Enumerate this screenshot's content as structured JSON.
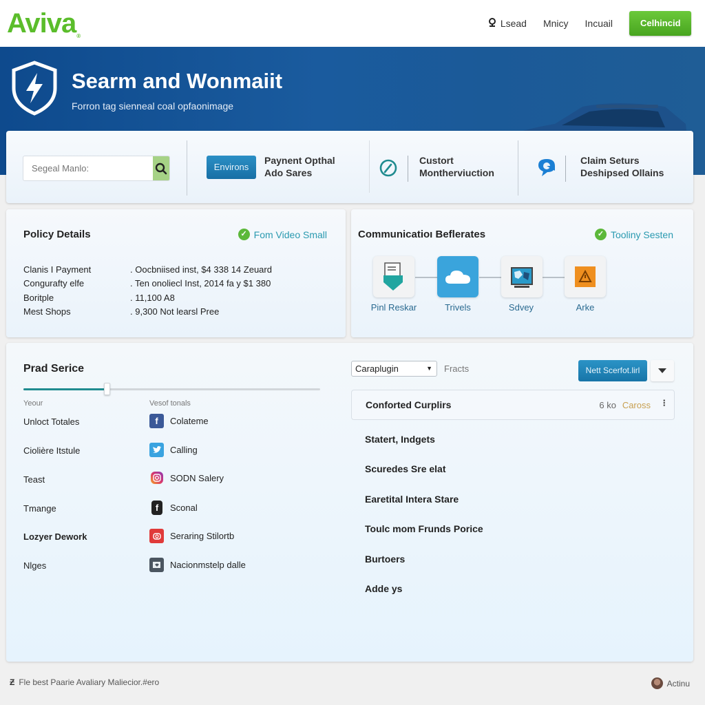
{
  "header": {
    "logo": "Aviva",
    "logo_mark": "®",
    "nav": [
      {
        "label": "Lsead",
        "icon": "location-pin-icon"
      },
      {
        "label": "Mnicy"
      },
      {
        "label": "Incuail"
      }
    ],
    "cta_label": "Celhincid"
  },
  "hero": {
    "title": "Searm and Wonmaiit",
    "subtitle": "Forron tag sienneal coal opfaonimage",
    "icon": "shield-lightning-icon"
  },
  "service_strip": {
    "search": {
      "placeholder": "Segeal Manlo:",
      "value": ""
    },
    "environs_button": "Environs",
    "items": [
      {
        "line1": "Paynent Opthal",
        "line2": "Ado Sares"
      },
      {
        "line1": "Custort",
        "line2": "Montherviuction",
        "icon": "gauge-icon"
      },
      {
        "line1": "Claim Seturs",
        "line2": "Deshipsed Ollains",
        "icon": "chat-refresh-icon"
      }
    ]
  },
  "policy_details": {
    "title": "Policy Details",
    "badge": "Fom Video Small",
    "rows": [
      {
        "label": "Clanis I Payment",
        "value": ". Oocbniised inst, $4 338 14 Zeuard"
      },
      {
        "label": "Congurafty elfe",
        "value": ". Ten onoliecl Inst, 2014 fa y $1 380"
      },
      {
        "label": "Boritple",
        "value": ". 11,100 A8"
      },
      {
        "label": "Mest Shops",
        "value": ". 9,300 Not learsl Pree"
      }
    ]
  },
  "communication": {
    "title": "Communicatioı Beflerates",
    "badge": "Tooliny Sesten",
    "steps": [
      {
        "label": "Pinl Reskar",
        "icon": "document-shield-icon"
      },
      {
        "label": "Trivels",
        "icon": "cloud-icon"
      },
      {
        "label": "Sdvey",
        "icon": "monitor-map-icon"
      },
      {
        "label": "Arke",
        "icon": "warning-icon"
      }
    ]
  },
  "prad_service": {
    "title": "Prad Serice",
    "slider_fraction": 0.28,
    "col_left_header": "Yeour",
    "col_right_header": "Vesof tonals",
    "left_items": [
      "Unloct Totales",
      "Ciolière Itstule",
      "Teast",
      "Tmange",
      "Lozyer Dework",
      "Nlges"
    ],
    "social_items": [
      {
        "label": "Colateme",
        "icon": "facebook-icon",
        "color": "#3b5998"
      },
      {
        "label": "Calling",
        "icon": "twitter-icon",
        "color": "#3aa3e0"
      },
      {
        "label": "SODN Salery",
        "icon": "instagram-icon",
        "color": "#d9376e"
      },
      {
        "label": "Sconal",
        "icon": "dark-f-icon",
        "color": "#222222"
      },
      {
        "label": "Seraring Stilortb",
        "icon": "red-app-icon",
        "color": "#e03a3a"
      },
      {
        "label": "Nacionmstelp dalle",
        "icon": "slate-app-icon",
        "color": "#4a5560"
      }
    ]
  },
  "right_panel": {
    "select_value": "Caraplugin",
    "facts_label": "Fracts",
    "next_button": "Nett Scerfot.lirl",
    "list_header": {
      "title": "Conforted Curplirs",
      "size": "6 ko",
      "status": "Caross"
    },
    "items": [
      "Statert, Indgets",
      "Scuredes Sre elat",
      "Earetital Intera Stare",
      "Toulc mom Frunds Porice",
      "Burtoers",
      "Adde ys"
    ]
  },
  "footer": {
    "left_text": "Fle best Paarie Avaliary Maliecior.#ero",
    "right_text": "Actinu"
  },
  "colors": {
    "brand_green": "#5bbd2b",
    "hero_blue": "#135293",
    "button_blue": "#1f7fb5",
    "badge_check": "#5cb83a",
    "badge_text": "#2a9ab0"
  }
}
